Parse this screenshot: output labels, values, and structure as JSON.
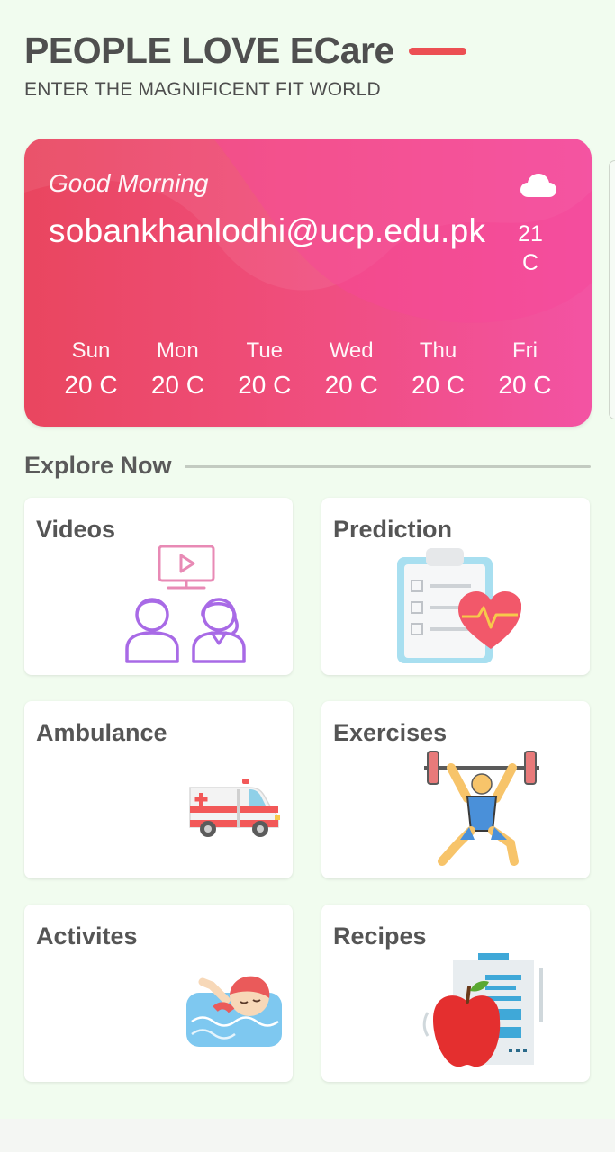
{
  "header": {
    "title": "PEOPLE LOVE ECare",
    "subtitle": "ENTER THE MAGNIFICENT FIT WORLD",
    "accent_color": "#ec4f53"
  },
  "weather": {
    "greeting": "Good Morning",
    "user_email": "sobankhanlodhi@ucp.edu.pk",
    "current_temp": "21 C",
    "icon": "cloud-icon",
    "forecast": [
      {
        "day": "Sun",
        "temp": "20 C"
      },
      {
        "day": "Mon",
        "temp": "20 C"
      },
      {
        "day": "Tue",
        "temp": "20 C"
      },
      {
        "day": "Wed",
        "temp": "20 C"
      },
      {
        "day": "Thu",
        "temp": "20 C"
      },
      {
        "day": "Fri",
        "temp": "20 C"
      }
    ]
  },
  "explore": {
    "title": "Explore Now",
    "tiles": [
      {
        "label": "Videos",
        "icon": "video-consultation-icon"
      },
      {
        "label": "Prediction",
        "icon": "clipboard-heart-icon"
      },
      {
        "label": "Ambulance",
        "icon": "ambulance-icon"
      },
      {
        "label": "Exercises",
        "icon": "weightlifter-icon"
      },
      {
        "label": "Activites",
        "icon": "swimmer-icon"
      },
      {
        "label": "Recipes",
        "icon": "apple-recipe-icon"
      }
    ]
  }
}
